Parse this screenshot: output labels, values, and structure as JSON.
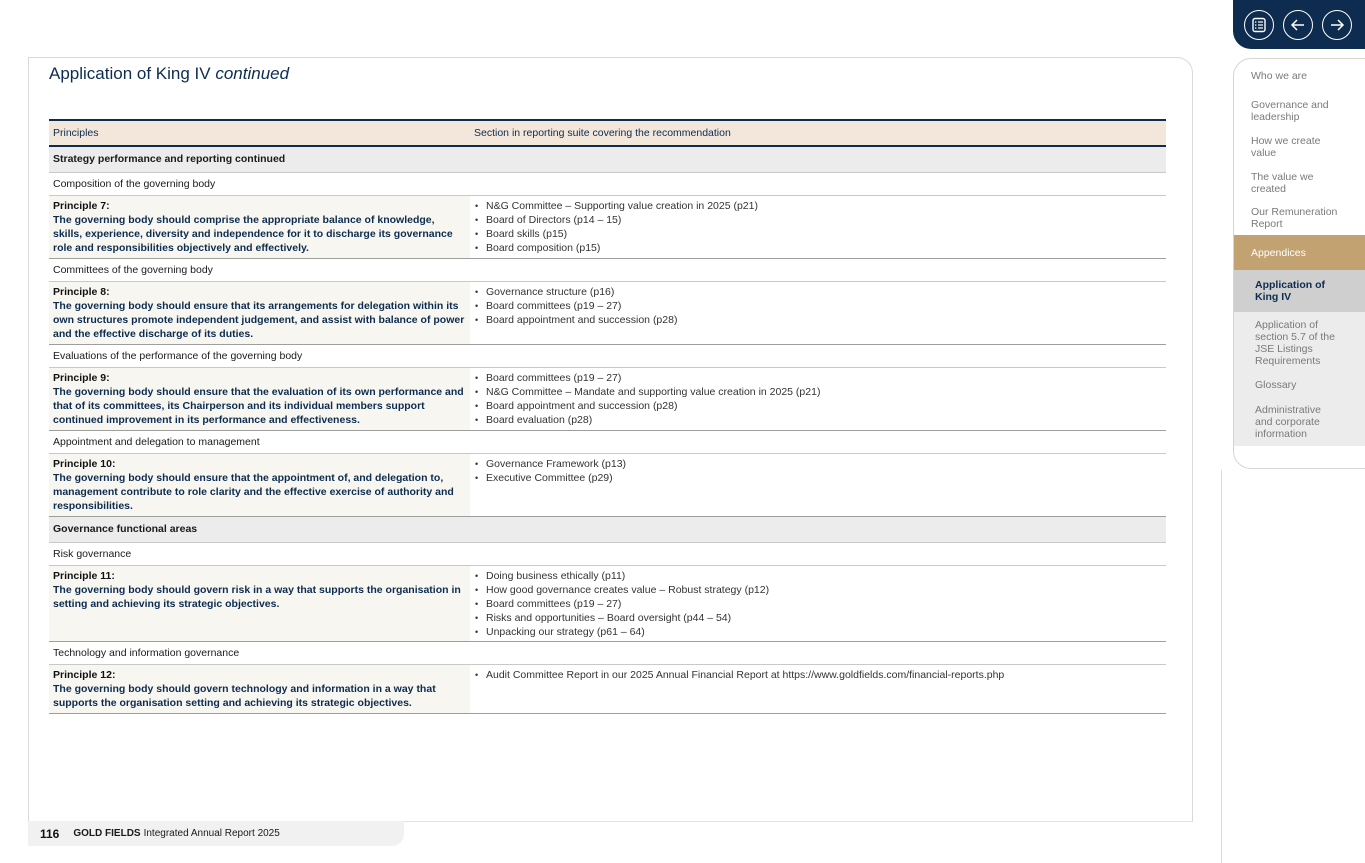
{
  "page": {
    "title": "Application of King IV",
    "title_suffix": "continued"
  },
  "table": {
    "headers": [
      "Principles",
      "Section in reporting suite covering the recommendation"
    ],
    "section1": "Strategy performance and reporting continued",
    "section2": "Governance functional areas",
    "groups": [
      {
        "subheading": "Composition of the governing body",
        "principle_label": "Principle 7:",
        "principle_text": "The governing body should comprise the appropriate balance of knowledge, skills, experience, diversity and independence for it to discharge its governance role and responsibilities objectively and effectively.",
        "refs": [
          "N&G Committee – Supporting value creation in 2025 (p21)",
          "Board of Directors (p14 – 15)",
          "Board skills (p15)",
          "Board composition (p15)"
        ]
      },
      {
        "subheading": "Committees of the governing body",
        "principle_label": "Principle 8:",
        "principle_text": "The governing body should ensure that its arrangements for delegation within its own structures promote independent judgement, and assist with balance of power and the effective discharge of its duties.",
        "refs": [
          "Governance structure (p16)",
          "Board committees (p19 – 27)",
          "Board appointment and succession (p28)"
        ]
      },
      {
        "subheading": "Evaluations of the performance of the governing body",
        "principle_label": "Principle 9:",
        "principle_text": "The governing body should ensure that the evaluation of its own performance and that of its committees, its Chairperson and its individual members support continued improvement in its performance and effectiveness.",
        "refs": [
          "Board committees (p19 – 27)",
          "N&G Committee – Mandate and supporting value creation in 2025 (p21)",
          "Board appointment and succession (p28)",
          "Board evaluation (p28)"
        ]
      },
      {
        "subheading": "Appointment and delegation to management",
        "principle_label": "Principle 10:",
        "principle_text": "The governing body should ensure that the appointment of, and delegation to, management contribute to role clarity and the effective exercise of authority and responsibilities.",
        "refs": [
          "Governance Framework (p13)",
          "Executive Committee (p29)"
        ]
      },
      {
        "subheading": "Risk governance",
        "principle_label": "Principle 11:",
        "principle_text": "The governing body should govern risk in a way that supports the organisation in setting and achieving its strategic objectives.",
        "refs": [
          "Doing business ethically (p11)",
          "How good governance creates value – Robust strategy (p12)",
          "Board committees (p19 – 27)",
          "Risks and opportunities – Board oversight (p44 – 54)",
          "Unpacking our strategy (p61 – 64)"
        ]
      },
      {
        "subheading": "Technology and information governance",
        "principle_label": "Principle 12:",
        "principle_text": "The governing body should govern technology and information in a way that supports the organisation setting and achieving its strategic objectives.",
        "refs": [
          "Audit Committee Report in our 2025 Annual Financial Report at https://www.goldfields.com/financial-reports.php"
        ]
      }
    ]
  },
  "footer": {
    "page_number": "116",
    "brand": "GOLD FIELDS",
    "publication": "Integrated Annual Report 2025"
  },
  "nav": {
    "buttons": [
      "contents-icon",
      "arrow-left-icon",
      "arrow-right-icon"
    ],
    "items": [
      "Who we are",
      "Governance and leadership",
      "How we create value",
      "The value we created",
      "Our Remuneration Report",
      "Appendices"
    ],
    "subitems": [
      "Application of King IV",
      "Application of section 5.7 of the JSE Listings Requirements",
      "Glossary",
      "Administrative and corporate information"
    ]
  },
  "colors": {
    "navy": "#0d2c4f",
    "gold": "#c2a271",
    "header_bg": "#f3e6da"
  }
}
